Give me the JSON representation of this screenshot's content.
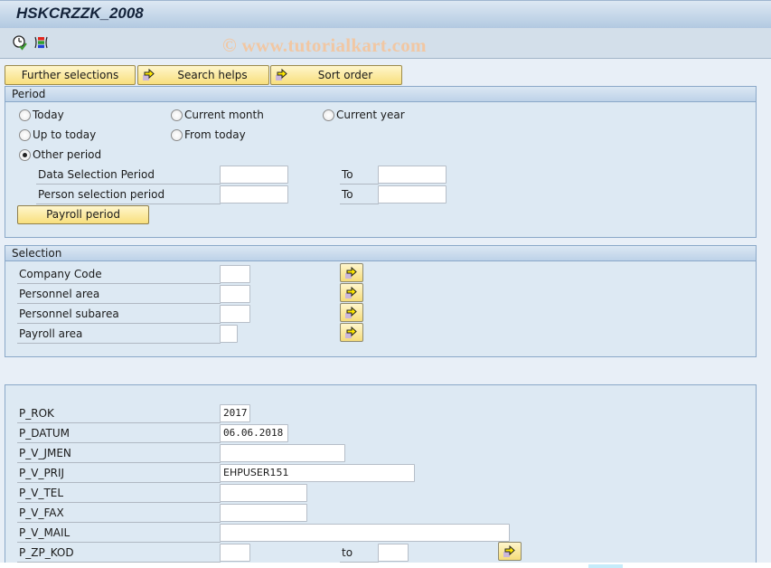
{
  "window": {
    "title": "HSKCRZZK_2008"
  },
  "toolbar": {
    "icons": [
      {
        "name": "execute-clock-icon",
        "tooltip": "Execute"
      },
      {
        "name": "selection-options-icon",
        "tooltip": "Selection options"
      }
    ],
    "watermark": "© www.tutorialkart.com"
  },
  "top_buttons": [
    {
      "label": "Further selections",
      "icon": null
    },
    {
      "label": "Search helps",
      "icon": "arrow-right-icon"
    },
    {
      "label": "Sort order",
      "icon": "arrow-right-icon"
    }
  ],
  "period": {
    "title": "Period",
    "radios": [
      {
        "label": "Today",
        "checked": false
      },
      {
        "label": "Current month",
        "checked": false
      },
      {
        "label": "Current year",
        "checked": false
      },
      {
        "label": "Up to today",
        "checked": false
      },
      {
        "label": "From today",
        "checked": false
      },
      {
        "label": "Other period",
        "checked": true
      }
    ],
    "rows": [
      {
        "label": "Data Selection Period",
        "from": "",
        "to_label": "To",
        "to": ""
      },
      {
        "label": "Person selection period",
        "from": "",
        "to_label": "To",
        "to": ""
      }
    ],
    "payroll_button": "Payroll period"
  },
  "selection": {
    "title": "Selection",
    "rows": [
      {
        "label": "Company Code",
        "value": ""
      },
      {
        "label": "Personnel area",
        "value": ""
      },
      {
        "label": "Personnel subarea",
        "value": ""
      },
      {
        "label": "Payroll area",
        "value": ""
      }
    ]
  },
  "parameters": {
    "rows": [
      {
        "label": "P_ROK",
        "value": "2017"
      },
      {
        "label": "P_DATUM",
        "value": "06.06.2018"
      },
      {
        "label": "P_V_JMEN",
        "value": ""
      },
      {
        "label": "P_V_PRIJ",
        "value": "EHPUSER151"
      },
      {
        "label": "P_V_TEL",
        "value": ""
      },
      {
        "label": "P_V_FAX",
        "value": ""
      },
      {
        "label": "P_V_MAIL",
        "value": ""
      },
      {
        "label": "P_ZP_KOD",
        "value": "",
        "to_label": "to",
        "to": ""
      }
    ]
  },
  "colors": {
    "button_yellow": "#f8df7d",
    "frame_bg": "#dde9f3",
    "frame_border": "#8aa8c8",
    "title_text": "#14233a"
  }
}
